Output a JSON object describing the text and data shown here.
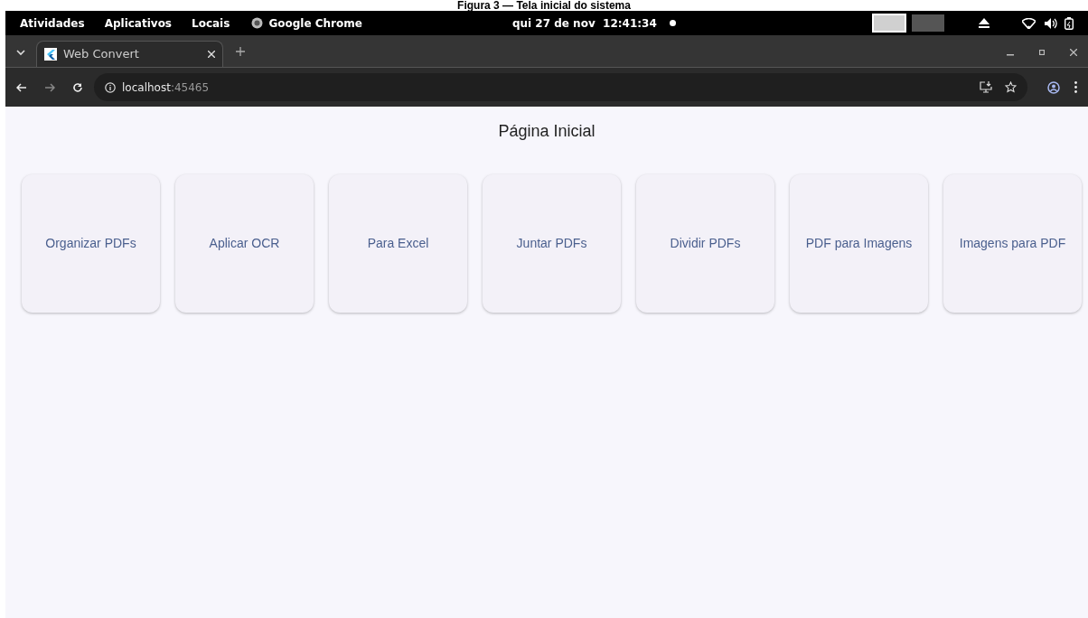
{
  "caption": "Figura 3 — Tela inicial do sistema",
  "top_bar": {
    "menus": [
      "Atividades",
      "Aplicativos",
      "Locais"
    ],
    "app": "Google Chrome",
    "clock": "qui 27 de nov  12:41:34"
  },
  "tabs": [
    {
      "title": "Web Convert",
      "selected": true
    }
  ],
  "address_bar": {
    "host": "localhost",
    "port": ":45465"
  },
  "page": {
    "title": "Página Inicial",
    "cards": [
      "Organizar PDFs",
      "Aplicar OCR",
      "Para Excel",
      "Juntar PDFs",
      "Dividir PDFs",
      "PDF para Imagens",
      "Imagens para PDF"
    ]
  }
}
